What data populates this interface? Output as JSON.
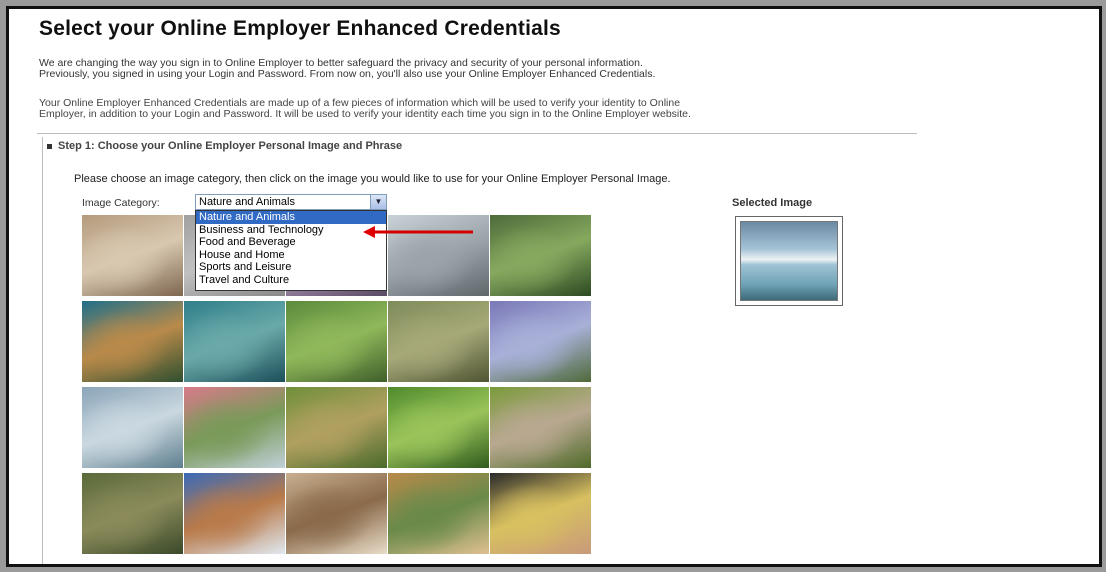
{
  "page": {
    "title": "Select your Online Employer Enhanced Credentials",
    "intro_lines": [
      "We are changing the way you sign in to Online Employer to better safeguard the privacy and security of your personal information.",
      "Previously, you signed in using your Login and Password. From now on, you'll also use your Online Employer Enhanced Credentials."
    ],
    "intro2_lines": [
      "Your Online Employer Enhanced Credentials are made up of a few pieces of information which will be used to verify your identity to Online",
      "Employer, in addition to your Login and Password. It will be used to verify your identity each time you sign in to the Online Employer website."
    ]
  },
  "step": {
    "heading": "Step 1: Choose your Online Employer Personal Image and Phrase",
    "instruction": "Please choose an image category, then click on the image you would like to use for your Online Employer Personal Image.",
    "category_label": "Image Category:",
    "selected_value": "Nature and Animals",
    "options": [
      "Nature and Animals",
      "Business and Technology",
      "Food and Beverage",
      "House and Home",
      "Sports and Leisure",
      "Travel and Culture"
    ],
    "selected_image_label": "Selected Image"
  },
  "images": [
    {
      "name": "deer-image",
      "colors": [
        "#b49a7c",
        "#d8c8b0",
        "#7e6650"
      ]
    },
    {
      "name": "hidden-image-2",
      "colors": [
        "#a0a0a0",
        "#c0c0c0",
        "#888"
      ]
    },
    {
      "name": "hidden-image-3",
      "colors": [
        "#7b6b8a",
        "#a890b0",
        "#5a4a66"
      ]
    },
    {
      "name": "bird-on-post-image",
      "colors": [
        "#c9d2d6",
        "#9aa4aa",
        "#5f676b"
      ]
    },
    {
      "name": "blue-jay-image",
      "colors": [
        "#4d6b3a",
        "#86a85e",
        "#2c4a22"
      ]
    },
    {
      "name": "peacock-image",
      "colors": [
        "#1f6f8a",
        "#b98a4a",
        "#2f4f2f"
      ]
    },
    {
      "name": "underwater-image",
      "colors": [
        "#2f7f8a",
        "#6aa9a9",
        "#1c4f5a"
      ]
    },
    {
      "name": "forest-pond-image",
      "colors": [
        "#5b8a3c",
        "#8fb85a",
        "#3f5f2a"
      ]
    },
    {
      "name": "rhino-image",
      "colors": [
        "#7e8c5a",
        "#a6a878",
        "#4f5533"
      ]
    },
    {
      "name": "blue-flowers-image",
      "colors": [
        "#7a78b8",
        "#a8b0d8",
        "#4f6a3a"
      ]
    },
    {
      "name": "seascape-image",
      "colors": [
        "#8aa4b8",
        "#cad8e0",
        "#5f7f8f"
      ]
    },
    {
      "name": "tulips-image",
      "colors": [
        "#d87a8a",
        "#7a9a5a",
        "#c0d0d8"
      ]
    },
    {
      "name": "pasture-fence-image",
      "colors": [
        "#6f8f3a",
        "#b0a060",
        "#4a6a2a"
      ]
    },
    {
      "name": "park-trees-image",
      "colors": [
        "#4f8a2c",
        "#9ac45a",
        "#2f5a1c"
      ]
    },
    {
      "name": "dove-image",
      "colors": [
        "#7a9a3a",
        "#b8a890",
        "#4f6a2a"
      ]
    },
    {
      "name": "frog-image",
      "colors": [
        "#5a6a3a",
        "#8a8a5a",
        "#3a4a2a"
      ]
    },
    {
      "name": "canyon-sky-image",
      "colors": [
        "#3a6ab8",
        "#b87a4a",
        "#e0e8f0"
      ]
    },
    {
      "name": "prairie-dog-image",
      "colors": [
        "#c8b090",
        "#8a6a4a",
        "#e8dcc8"
      ]
    },
    {
      "name": "giraffes-image",
      "colors": [
        "#b88a4a",
        "#6a8a4a",
        "#e0c090"
      ]
    },
    {
      "name": "duckling-image",
      "colors": [
        "#2a2a2a",
        "#d8c060",
        "#c89a7a"
      ]
    }
  ]
}
